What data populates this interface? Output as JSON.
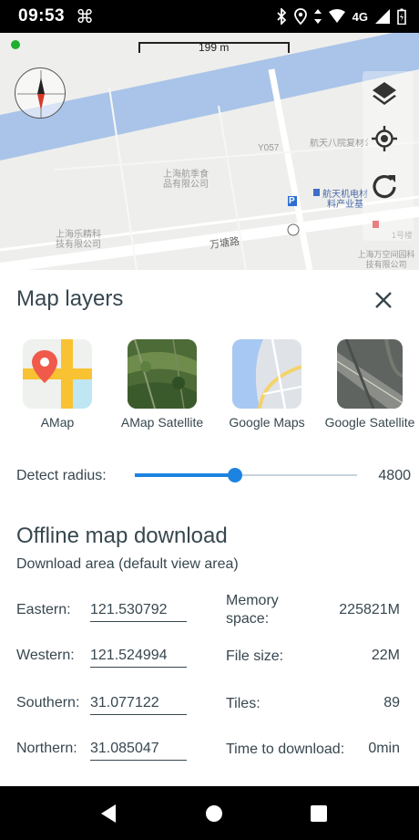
{
  "status_bar": {
    "time": "09:53",
    "app_icon": "command-icon",
    "network": "4G",
    "icons": [
      "bluetooth-icon",
      "location-icon",
      "data-arrows-icon",
      "wifi-icon",
      "signal-icon",
      "battery-icon"
    ]
  },
  "map": {
    "scale": "199 m",
    "road_label": "万塘路",
    "road_code": "Y057",
    "parking_sign": "P",
    "pois": [
      "上海航季食品有限公司",
      "航天八院复材公",
      "航天机电材料产业基",
      "上海乐精科技有限公司",
      "上海万空间园科技有限公司",
      "1号楼"
    ],
    "controls": [
      "layers-icon",
      "my-location-icon",
      "refresh-icon"
    ],
    "colors": {
      "water": "#a9c4e8",
      "land": "#eeeeec",
      "road": "#ffffff",
      "gps_dot": "#1fae32"
    }
  },
  "sheet": {
    "title": "Map layers",
    "close_icon": "close-icon",
    "layers": [
      {
        "name": "AMap",
        "icon": "amap-thumbnail"
      },
      {
        "name": "AMap Satellite",
        "icon": "amap-satellite-thumbnail"
      },
      {
        "name": "Google Maps",
        "icon": "google-maps-thumbnail"
      },
      {
        "name": "Google Satellite",
        "icon": "google-satellite-thumbnail"
      }
    ],
    "detect_radius": {
      "label": "Detect radius:",
      "value": "4800",
      "slider_fraction": 0.45
    },
    "offline": {
      "title": "Offline map download",
      "subtitle": "Download area (default view area)",
      "eastern": {
        "label": "Eastern:",
        "value": "121.530792"
      },
      "western": {
        "label": "Western:",
        "value": "121.524994"
      },
      "southern": {
        "label": "Southern:",
        "value": "31.077122"
      },
      "northern": {
        "label": "Northern:",
        "value": "31.085047"
      },
      "memory": {
        "label": "Memory space:",
        "value": "225821M"
      },
      "file_size": {
        "label": "File size:",
        "value": "22M"
      },
      "tiles": {
        "label": "Tiles:",
        "value": "89"
      },
      "time": {
        "label": "Time to download:",
        "value": "0min"
      }
    },
    "accent_color": "#1c83e1",
    "text_color": "#37474f"
  },
  "nav_bar": {
    "buttons": [
      "back-icon",
      "home-icon",
      "recents-icon"
    ]
  }
}
